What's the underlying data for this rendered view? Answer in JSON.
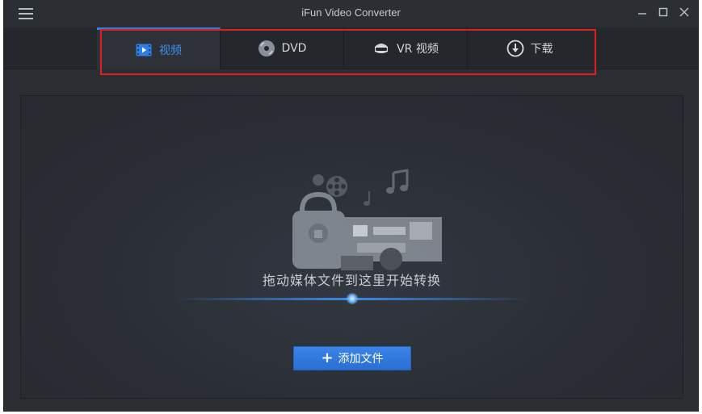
{
  "window": {
    "title": "iFun Video Converter"
  },
  "tabs": [
    {
      "label": "视频",
      "icon": "film-icon",
      "active": true
    },
    {
      "label": "DVD",
      "icon": "disc-icon",
      "active": false
    },
    {
      "label": "VR 视频",
      "icon": "vr-headset-icon",
      "active": false
    },
    {
      "label": "下载",
      "icon": "download-icon",
      "active": false
    }
  ],
  "drop_area": {
    "hint": "拖动媒体文件到这里开始转换",
    "add_button_label": "添加文件",
    "illustration_icons": [
      "film-reel-icon",
      "music-note-icon",
      "lock-file-icon",
      "media-folder-icon"
    ]
  },
  "colors": {
    "accent": "#2f7fe3",
    "highlight_border": "#e02020",
    "background": "#2b2e33"
  }
}
